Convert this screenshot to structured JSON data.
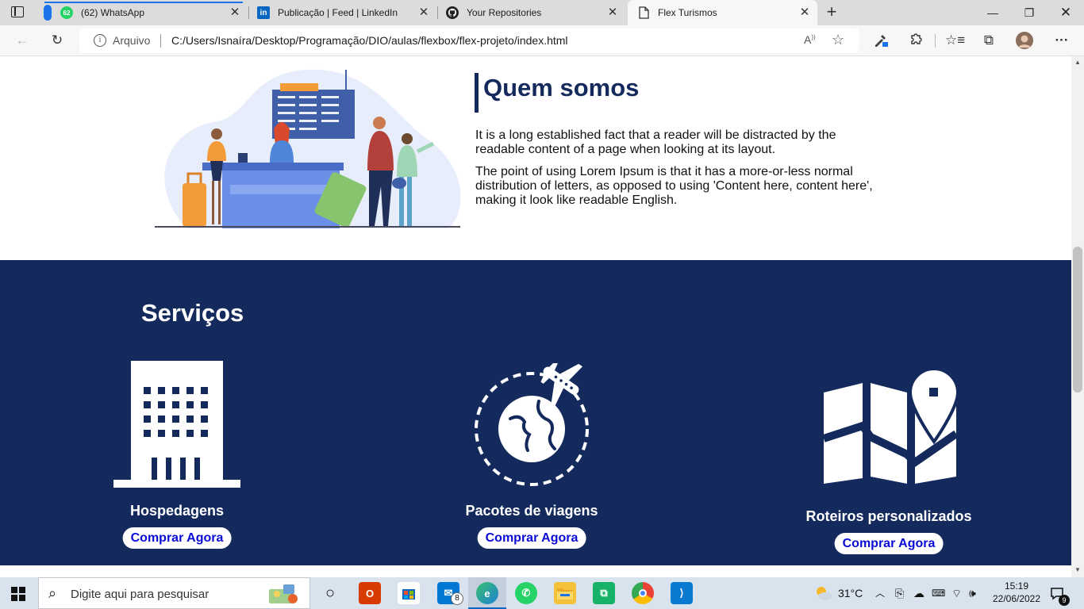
{
  "browser": {
    "tabs": [
      {
        "title": "(62) WhatsApp",
        "badge": "62",
        "icon": "whatsapp-icon"
      },
      {
        "title": "Publicação | Feed | LinkedIn",
        "icon": "linkedin-icon"
      },
      {
        "title": "Your Repositories",
        "icon": "github-icon"
      },
      {
        "title": "Flex Turismos",
        "icon": "page-icon",
        "active": true
      }
    ],
    "address": {
      "scheme_label": "Arquivo",
      "url": "C:/Users/Isnaíra/Desktop/Programação/DIO/aulas/flexbox/flex-projeto/index.html"
    }
  },
  "page": {
    "about": {
      "title": "Quem somos",
      "paragraphs": [
        "It is a long established fact that a reader will be distracted by the readable content of a page when looking at its layout.",
        "The point of using Lorem Ipsum is that it has a more-or-less normal distribution of letters, as opposed to using 'Content here, content here', making it look like readable English."
      ]
    },
    "services": {
      "title": "Serviços",
      "items": [
        {
          "name": "Hospedagens",
          "button": "Comprar Agora",
          "icon": "hotel-building-icon"
        },
        {
          "name": "Pacotes de viagens",
          "button": "Comprar Agora",
          "icon": "globe-airplane-icon"
        },
        {
          "name": "Roteiros personalizados",
          "button": "Comprar Agora",
          "icon": "map-pin-icon"
        }
      ]
    },
    "colors": {
      "primary": "#142a5c",
      "button_text": "#0a0ad6"
    }
  },
  "taskbar": {
    "search_placeholder": "Digite aqui para pesquisar",
    "mail_badge": "8",
    "weather": "31°C",
    "time": "15:19",
    "date": "22/06/2022",
    "notifications": "9"
  }
}
